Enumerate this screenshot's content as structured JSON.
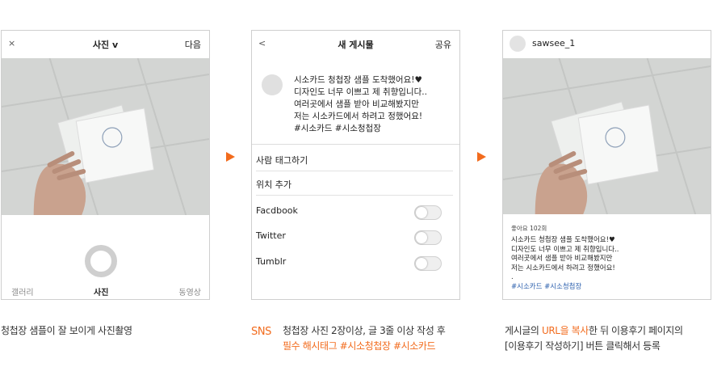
{
  "colors": {
    "accent": "#f26b1d",
    "hashtag": "#2b5fad"
  },
  "panel1": {
    "close_icon": "×",
    "title": "사진 v",
    "next": "다음",
    "tabs": [
      "갤러리",
      "사진",
      "동영상"
    ]
  },
  "panel2": {
    "back_icon": "<",
    "title": "새 게시물",
    "share": "공유",
    "caption": [
      "시소카드 청첩장 샘플 도착했어요!♥",
      "디자인도 너무 이쁘고 제 취향입니다..",
      "여러곳에서 샘플 받아 비교해봤지만",
      "저는 시소카드에서 하려고 정했어요!",
      "#시소카드 #시소청첩장"
    ],
    "tag_people": "사람 태그하기",
    "add_location": "위치 추가",
    "share_targets": [
      "Facdbook",
      "Twitter",
      "Tumblr"
    ]
  },
  "panel3": {
    "username": "sawsee_1",
    "likes": "좋아요 102회",
    "caption": [
      "시소카드 청첩장 샘플 도착했어요!♥",
      "디자인도 너무 이쁘고 제 취향입니다..",
      "여러곳에서 샘플 받아 비교해봤지만",
      "저는 시소카드에서 하려고 정했어요!",
      "."
    ],
    "hashtags": "#시소카드 #시소청첩장"
  },
  "descriptions": {
    "step1": "청첩장 샘플이 잘 보이게 사진촬영",
    "sns_label": "SNS",
    "step2_line1": "청첩장 사진 2장이상, 글 3줄 이상 작성 후",
    "step2_line2": "필수 해시태그 #시소청첩장 #시소카드",
    "step3_pre": "게시글의 ",
    "step3_hl": "URL을 복사",
    "step3_post": "한 뒤 이용후기 페이지의",
    "step3_line2": "[이용후기 작성하기] 버튼 클릭해서 등록"
  }
}
